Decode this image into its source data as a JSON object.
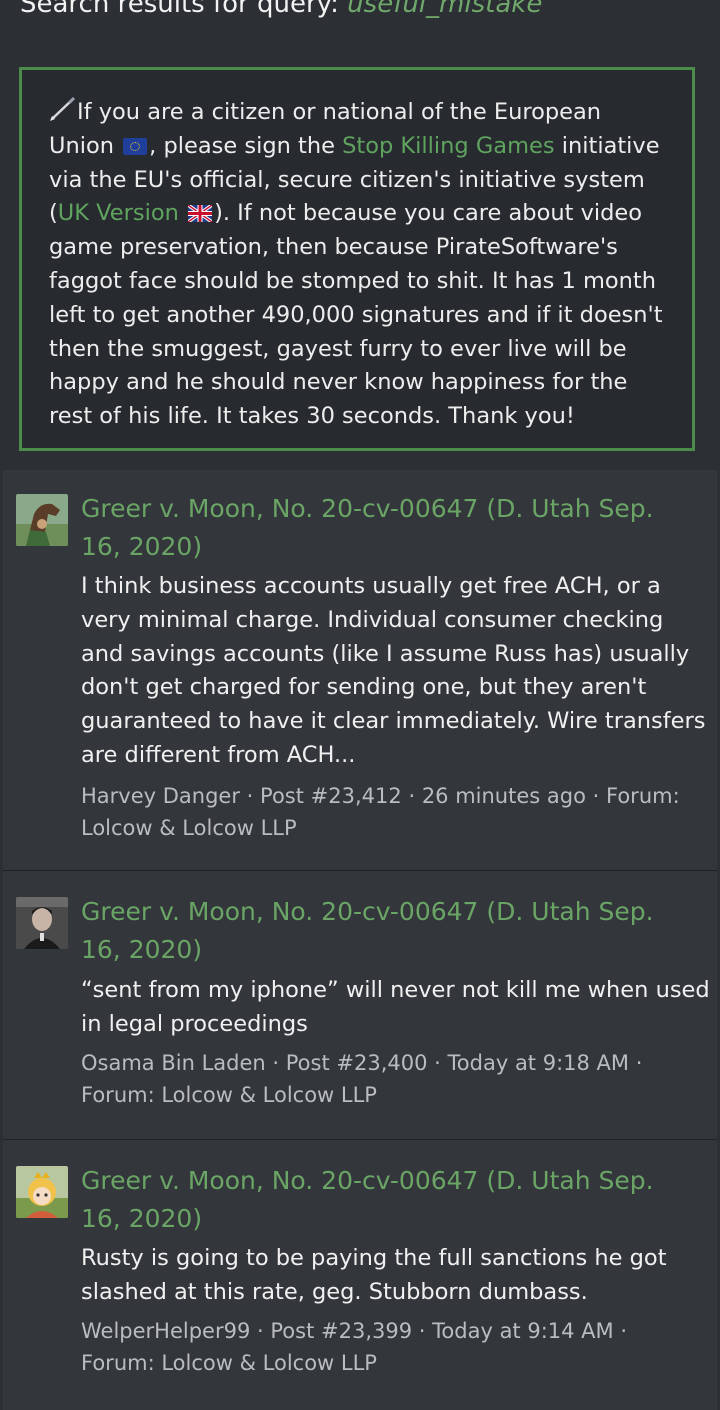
{
  "header": {
    "prefix": "Search results for query:",
    "query": "useful_mistake"
  },
  "notice": {
    "pen_icon": "pen-icon",
    "t1": "If you are a citizen or national of the European Union",
    "eu_flag": "eu-flag-icon",
    "t2": ", please sign the",
    "link1": "Stop Killing Games",
    "t3": "initiative via the EU's official, secure citizen's initiative system (",
    "link2": "UK Version",
    "uk_flag": "uk-flag-icon",
    "t4": "). If not because you care about video game preservation, then because PirateSoftware's faggot face should be stomped to shit. It has 1 month left to get another 490,000 signatures and if it doesn't then the smuggest, gayest furry to ever live will be happy and he should never know happiness for the rest of his life. It takes 30 seconds. Thank you!",
    "accent": "#4b8c4b"
  },
  "results": [
    {
      "avatar": "horse-avatar",
      "title": "Greer v. Moon, No. 20-cv-00647 (D. Utah Sep. 16, 2020)",
      "snippet": "I think business accounts usually get free ACH, or a very minimal charge. Individual consumer checking and savings accounts (like I assume Russ has) usually don't get charged for sending one, but they aren't guaranteed to have it clear immediately. Wire transfers are different from ACH...",
      "author": "Harvey Danger",
      "post": "Post #23,412",
      "time": "26 minutes ago",
      "forum_label": "Forum:",
      "forum": "Lolcow & Lolcow LLP"
    },
    {
      "avatar": "man-portrait-avatar",
      "title": "Greer v. Moon, No. 20-cv-00647 (D. Utah Sep. 16, 2020)",
      "snippet": "“sent from my iphone” will never not kill me when used in legal proceedings",
      "author": "Osama Bin Laden",
      "post": "Post #23,400",
      "time": "Today at 9:18 AM",
      "forum_label": "Forum:",
      "forum": "Lolcow & Lolcow LLP"
    },
    {
      "avatar": "anime-girl-avatar",
      "title": "Greer v. Moon, No. 20-cv-00647 (D. Utah Sep. 16, 2020)",
      "snippet": "Rusty is going to be paying the full sanctions he got slashed at this rate, geg. Stubborn dumbass.",
      "author": "WelperHelper99",
      "post": "Post #23,399",
      "time": "Today at 9:14 AM",
      "forum_label": "Forum:",
      "forum": "Lolcow & Lolcow LLP"
    }
  ],
  "colors": {
    "background": "#2c2f34",
    "card": "#33363b",
    "link": "#6aa566"
  }
}
